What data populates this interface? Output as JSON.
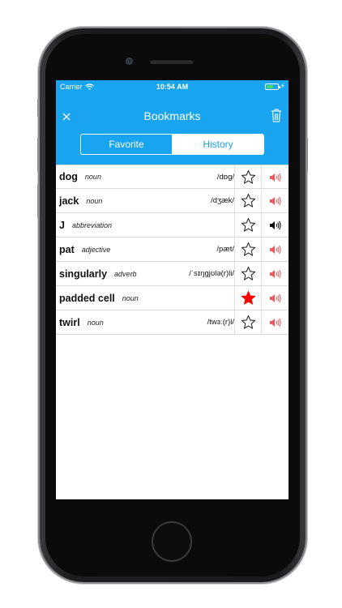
{
  "status_bar": {
    "carrier": "Carrier",
    "time": "10:54 AM"
  },
  "header": {
    "title": "Bookmarks",
    "tabs": [
      {
        "label": "Favorite",
        "selected": false
      },
      {
        "label": "History",
        "selected": true
      }
    ]
  },
  "colors": {
    "accent": "#18a4ee",
    "favorite_star": "#ff0000",
    "speaker_active": "#f15a5a",
    "speaker_inactive": "#111111"
  },
  "entries": [
    {
      "word": "dog",
      "pos": "noun",
      "pron": "/dɒɡ/",
      "favorite": false,
      "speaker": "active"
    },
    {
      "word": "jack",
      "pos": "noun",
      "pron": "/dʒæk/",
      "favorite": false,
      "speaker": "active"
    },
    {
      "word": "J",
      "pos": "abbreviation",
      "pron": "",
      "favorite": false,
      "speaker": "inactive"
    },
    {
      "word": "pat",
      "pos": "adjective",
      "pron": "/pæt/",
      "favorite": false,
      "speaker": "active"
    },
    {
      "word": "singularly",
      "pos": "adverb",
      "pron": "/ˈsɪŋɡjʊlə(r)li/",
      "favorite": false,
      "speaker": "active"
    },
    {
      "word": "padded cell",
      "pos": "noun",
      "pron": "",
      "favorite": true,
      "speaker": "active"
    },
    {
      "word": "twirl",
      "pos": "noun",
      "pron": "/twɜː(r)l/",
      "favorite": false,
      "speaker": "active"
    }
  ]
}
